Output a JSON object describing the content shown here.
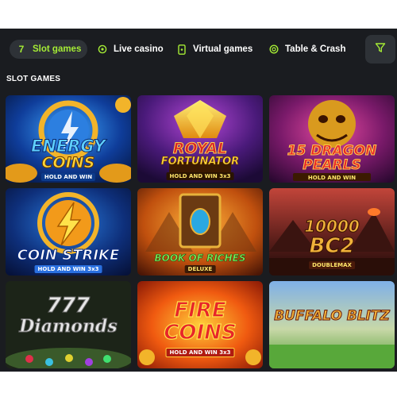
{
  "nav": {
    "tabs": [
      {
        "label": "Slot games",
        "icon": "seven-icon",
        "active": true
      },
      {
        "label": "Live casino",
        "icon": "live-icon",
        "active": false
      },
      {
        "label": "Virtual games",
        "icon": "phone-icon",
        "active": false
      },
      {
        "label": "Table & Crash",
        "icon": "chip-icon",
        "active": false
      }
    ],
    "filter_icon": "filter-icon"
  },
  "section": {
    "title": "SLOT GAMES"
  },
  "games": [
    {
      "title_line1": "ENERGY",
      "title_line2": "COINS",
      "subtitle": "HOLD AND WIN"
    },
    {
      "title_line1": "ROYAL",
      "title_line2": "FORTUNATOR",
      "subtitle": "HOLD AND WIN 3x3"
    },
    {
      "title_line1": "15 DRAGON",
      "title_line2": "PEARLS",
      "subtitle": "HOLD AND WIN"
    },
    {
      "title_line1": "COIN STRIKE",
      "title_line2": "",
      "subtitle": "HOLD AND WIN 3x3"
    },
    {
      "title_line1": "BOOK OF RICHES",
      "title_line2": "",
      "subtitle": "DELUXE"
    },
    {
      "title_line1": "10000",
      "title_line2": "BC2",
      "subtitle": "DOUBLEMAX"
    },
    {
      "title_line1": "777",
      "title_line2": "Diamonds",
      "subtitle": ""
    },
    {
      "title_line1": "FIRE",
      "title_line2": "COINS",
      "subtitle": "HOLD AND WIN 3x3"
    },
    {
      "title_line1": "BUFFALO BLITZ",
      "title_line2": "",
      "subtitle": ""
    }
  ],
  "colors": {
    "background": "#1a1c20",
    "accent": "#a5ec35",
    "tab_active_bg": "#2e3237"
  }
}
